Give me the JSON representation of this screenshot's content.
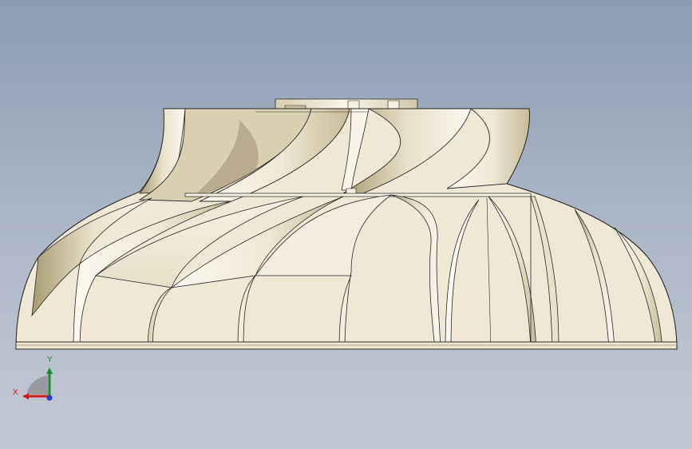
{
  "triad": {
    "x_label": "X",
    "y_label": "Y",
    "colors": {
      "x": "#d21e1e",
      "y": "#1c8c2a",
      "z": "#1f3fd6"
    }
  },
  "colors": {
    "background_top": "#8e9db2",
    "background_bottom": "#c3c9d4",
    "model_light": "#f7f2e6",
    "model_shade": "#b4a983",
    "outline": "#2a2a2a"
  }
}
